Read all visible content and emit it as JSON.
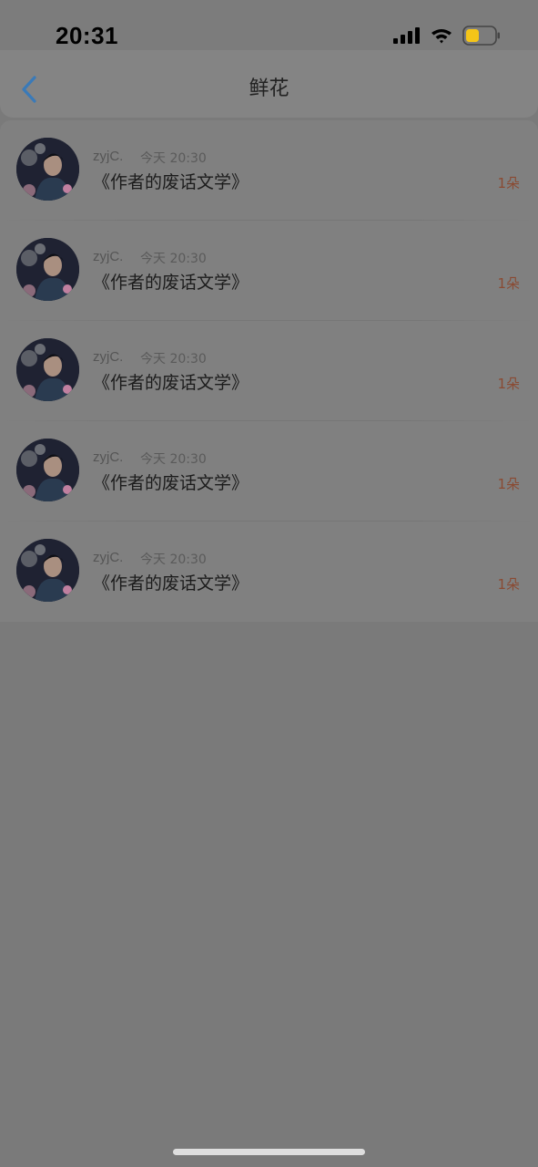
{
  "status_bar": {
    "time": "20:31",
    "battery_color": "#f5c518"
  },
  "header": {
    "title": "鲜花"
  },
  "flowers": [
    {
      "user": "zyjC.",
      "time": "今天 20:30",
      "title": "《作者的废话文学》",
      "count": "1朵"
    },
    {
      "user": "zyjC.",
      "time": "今天 20:30",
      "title": "《作者的废话文学》",
      "count": "1朵"
    },
    {
      "user": "zyjC.",
      "time": "今天 20:30",
      "title": "《作者的废话文学》",
      "count": "1朵"
    },
    {
      "user": "zyjC.",
      "time": "今天 20:30",
      "title": "《作者的废话文学》",
      "count": "1朵"
    },
    {
      "user": "zyjC.",
      "time": "今天 20:30",
      "title": "《作者的废话文学》",
      "count": "1朵"
    }
  ],
  "colors": {
    "accent": "#3a7ab8",
    "count": "#8a4a32"
  }
}
